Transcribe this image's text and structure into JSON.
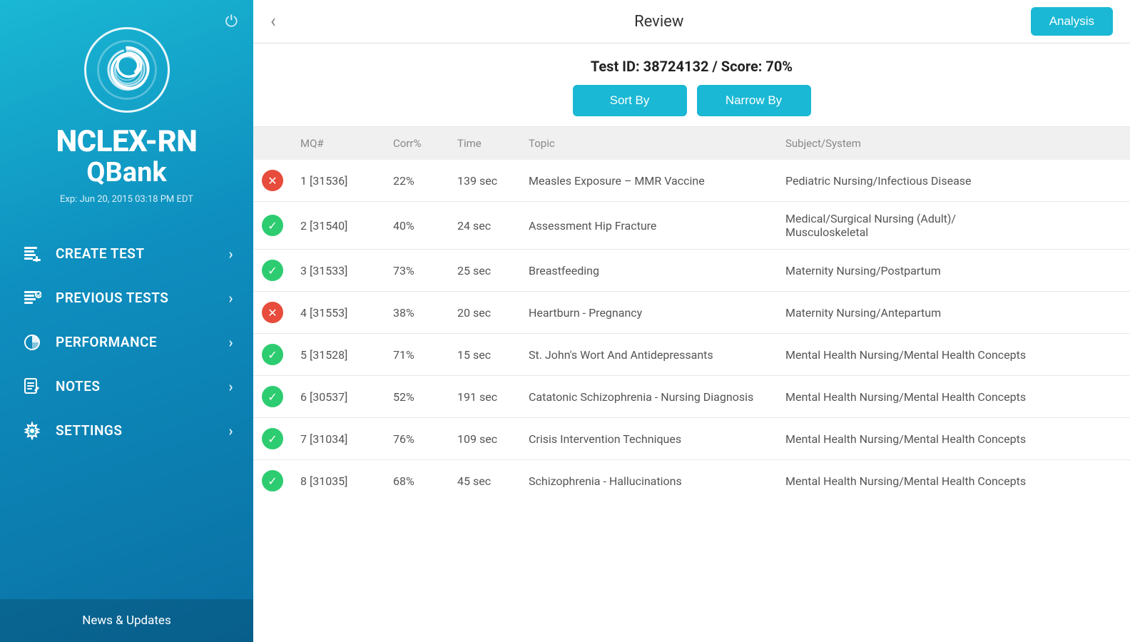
{
  "sidebar": {
    "power_icon": "⏻",
    "app_title": "NCLEX-RN",
    "app_subtitle": "QBank",
    "expiry": "Exp: Jun 20, 2015 03:18 PM EDT",
    "nav_items": [
      {
        "id": "create-test",
        "label": "CREATE TEST",
        "icon_type": "list"
      },
      {
        "id": "previous-tests",
        "label": "PREVIOUS TESTS",
        "icon_type": "list-check"
      },
      {
        "id": "performance",
        "label": "PERFORMANCE",
        "icon_type": "pie"
      },
      {
        "id": "notes",
        "label": "NOTES",
        "icon_type": "note"
      },
      {
        "id": "settings",
        "label": "SETTINGS",
        "icon_type": "gear"
      }
    ],
    "news_label": "News & Updates"
  },
  "header": {
    "back_label": "‹",
    "title": "Review",
    "analysis_label": "Analysis"
  },
  "score_area": {
    "score_text": "Test ID: 38724132 / Score: 70%",
    "sort_btn": "Sort By",
    "narrow_btn": "Narrow By"
  },
  "table": {
    "columns": [
      "",
      "MQ#",
      "Corr%",
      "Time",
      "Topic",
      "Subject/System"
    ],
    "rows": [
      {
        "status": "incorrect",
        "mq": "1 [31536]",
        "corr": "22%",
        "time": "139 sec",
        "topic": "Measles Exposure – MMR Vaccine",
        "subject": "Pediatric Nursing/Infectious Disease"
      },
      {
        "status": "correct",
        "mq": "2 [31540]",
        "corr": "40%",
        "time": "24 sec",
        "topic": "Assessment Hip Fracture",
        "subject": "Medical/Surgical Nursing (Adult)/\nMusculoskeletal"
      },
      {
        "status": "correct",
        "mq": "3 [31533]",
        "corr": "73%",
        "time": "25 sec",
        "topic": "Breastfeeding",
        "subject": "Maternity Nursing/Postpartum"
      },
      {
        "status": "incorrect",
        "mq": "4 [31553]",
        "corr": "38%",
        "time": "20 sec",
        "topic": "Heartburn - Pregnancy",
        "subject": "Maternity Nursing/Antepartum"
      },
      {
        "status": "correct",
        "mq": "5 [31528]",
        "corr": "71%",
        "time": "15 sec",
        "topic": "St. John's Wort And Antidepressants",
        "subject": "Mental Health Nursing/Mental Health Concepts"
      },
      {
        "status": "correct",
        "mq": "6 [30537]",
        "corr": "52%",
        "time": "191 sec",
        "topic": "Catatonic Schizophrenia - Nursing Diagnosis",
        "subject": "Mental Health Nursing/Mental Health Concepts"
      },
      {
        "status": "correct",
        "mq": "7 [31034]",
        "corr": "76%",
        "time": "109 sec",
        "topic": "Crisis Intervention Techniques",
        "subject": "Mental Health Nursing/Mental Health Concepts"
      },
      {
        "status": "correct",
        "mq": "8 [31035]",
        "corr": "68%",
        "time": "45 sec",
        "topic": "Schizophrenia - Hallucinations",
        "subject": "Mental Health Nursing/Mental Health Concepts"
      }
    ]
  },
  "colors": {
    "sidebar_gradient_top": "#1ab8d4",
    "sidebar_gradient_bottom": "#0a6fa3",
    "accent": "#1ab8d4",
    "correct_green": "#2ecc71",
    "incorrect_red": "#e74c3c"
  }
}
